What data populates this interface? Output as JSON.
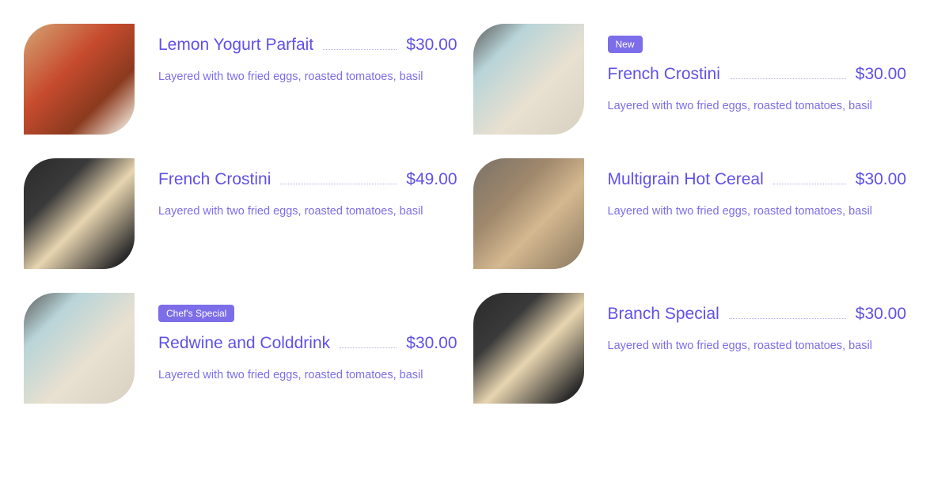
{
  "menu": {
    "items": [
      {
        "title": "Lemon Yogurt Parfait",
        "price": "$30.00",
        "description": "Layered with two fried eggs, roasted tomatoes, basil",
        "badge": null,
        "imageKind": "soup"
      },
      {
        "title": "French Crostini",
        "price": "$30.00",
        "description": "Layered with two fried eggs, roasted tomatoes, basil",
        "badge": "New",
        "imageKind": "dumplings"
      },
      {
        "title": "French Crostini",
        "price": "$49.00",
        "description": "Layered with two fried eggs, roasted tomatoes, basil",
        "badge": null,
        "imageKind": "noodle"
      },
      {
        "title": "Multigrain Hot Cereal",
        "price": "$30.00",
        "description": "Layered with two fried eggs, roasted tomatoes, basil",
        "badge": null,
        "imageKind": "gyoza"
      },
      {
        "title": "Redwine and Colddrink",
        "price": "$30.00",
        "description": "Layered with two fried eggs, roasted tomatoes, basil",
        "badge": "Chef's Special",
        "imageKind": "dumplings"
      },
      {
        "title": "Branch Special",
        "price": "$30.00",
        "description": "Layered with two fried eggs, roasted tomatoes, basil",
        "badge": null,
        "imageKind": "noodle"
      }
    ]
  }
}
